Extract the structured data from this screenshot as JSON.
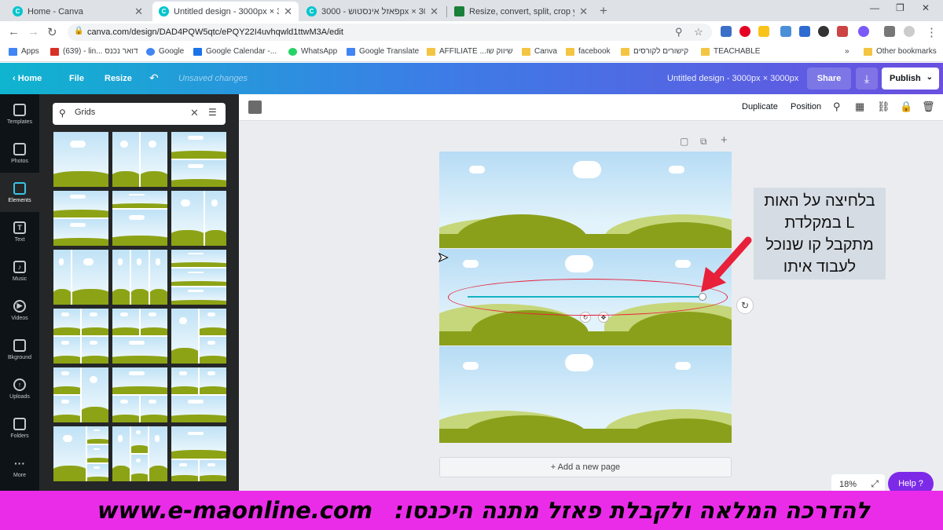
{
  "browser": {
    "tabs": [
      {
        "title": "Home - Canva",
        "icon": "canva-icon"
      },
      {
        "title": "Untitled design - 3000px × 3000",
        "icon": "canva-icon"
      },
      {
        "title": "פאזל אינסטוש - 3000px × 3000px",
        "icon": "canva-icon"
      },
      {
        "title": "Resize, convert, split, crop your im",
        "icon": "sheets-icon"
      }
    ],
    "url": "canva.com/design/DAD4PQW5qtc/ePQY22I4uvhqwld1ttwM3A/edit",
    "bookmarks": [
      "Apps",
      "(639) - lin... דואר נכנס",
      "Google",
      "Google Calendar -...",
      "WhatsApp",
      "Google Translate",
      "AFFILIATE ...שיווק שו",
      "Canva",
      "facebook",
      "קישורים לקורסים",
      "TEACHABLE",
      "Other bookmarks"
    ],
    "more_bookmarks": "»"
  },
  "header": {
    "home": "Home",
    "file": "File",
    "resize": "Resize",
    "status": "Unsaved changes",
    "design_title": "Untitled design - 3000px × 3000px",
    "share": "Share",
    "publish": "Publish"
  },
  "rail": [
    {
      "label": "Templates",
      "icon": "templates-icon"
    },
    {
      "label": "Photos",
      "icon": "photos-icon"
    },
    {
      "label": "Elements",
      "icon": "elements-icon"
    },
    {
      "label": "Text",
      "icon": "text-icon"
    },
    {
      "label": "Music",
      "icon": "music-icon"
    },
    {
      "label": "Videos",
      "icon": "videos-icon"
    },
    {
      "label": "Bkground",
      "icon": "background-icon"
    },
    {
      "label": "Uploads",
      "icon": "uploads-icon"
    },
    {
      "label": "Folders",
      "icon": "folders-icon"
    },
    {
      "label": "More",
      "icon": "more-icon"
    }
  ],
  "panel": {
    "search_value": "Grids"
  },
  "toolbar": {
    "duplicate": "Duplicate",
    "position": "Position"
  },
  "canvas": {
    "add_page": "+ Add a new page",
    "zoom": "18%",
    "help": "Help ?"
  },
  "callout": {
    "lines": [
      "בלחיצה על האות",
      "L במקלדת",
      "מתקבל קו שנוכל",
      "לעבוד איתו"
    ]
  },
  "banner": {
    "url_text": "www.e-maonline.com",
    "hebrew_text": "להדרכה המלאה ולקבלת פאזל מתנה היכנסו:"
  },
  "colors": {
    "accent": "#00c4cc",
    "brand_purple": "#7d2ae8",
    "banner": "#ea2ce9",
    "line": "#15b3c2",
    "annotation_red": "#e8203a"
  }
}
